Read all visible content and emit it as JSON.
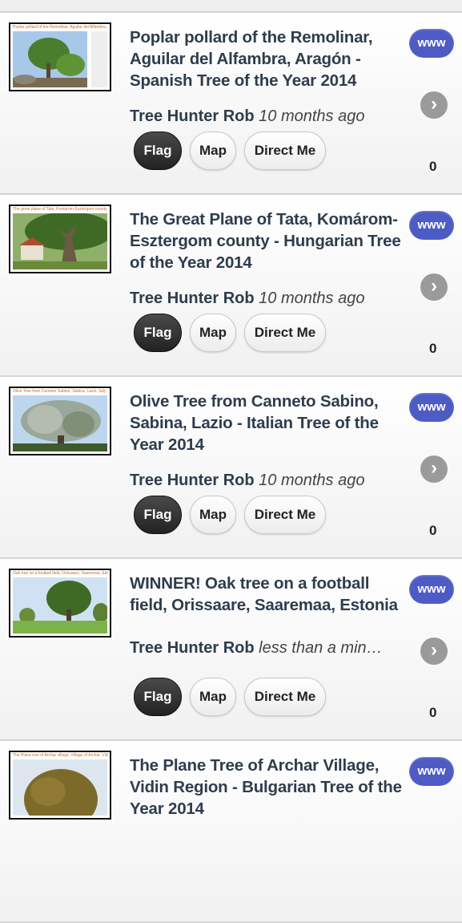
{
  "buttons": {
    "www": "www",
    "flag": "Flag",
    "map": "Map",
    "direct": "Direct Me",
    "arrow": "›"
  },
  "items": [
    {
      "title": "Poplar pollard of the Remolinar, Aguilar del Alfambra, Aragón - Spanish Tree of the Year 2014",
      "author": "Tree Hunter Rob",
      "time": "10 months ago",
      "count": "0",
      "thumb_caption": "Poplar pollard of the Remolinar, Aguilar del Alfambra, Aragón, Spain"
    },
    {
      "title": "The Great Plane of Tata, Komárom-Esztergom county - Hungarian Tree of the Year 2014",
      "author": "Tree Hunter Rob",
      "time": "10 months ago",
      "count": "0",
      "thumb_caption": "The great plane of Tata, Komárom-Esztergom county"
    },
    {
      "title": "Olive Tree from Canneto Sabino, Sabina, Lazio - Italian Tree of the Year 2014",
      "author": "Tree Hunter Rob",
      "time": "10 months ago",
      "count": "0",
      "thumb_caption": "Olive Tree from Canneto Sabino, Sabina, Lazio, Italy"
    },
    {
      "title": "WINNER! Oak tree on a football field, Orissaare, Saaremaa, Estonia",
      "author": "Tree Hunter Rob",
      "time": "less than a min…",
      "count": "0",
      "thumb_caption": "Oak tree on a football field, Orissaare, Saaremaa, Estonia"
    },
    {
      "title": "The Plane Tree of Archar Village, Vidin Region - Bulgarian Tree of the Year 2014",
      "author": "",
      "time": "",
      "count": "",
      "thumb_caption": "The Plane tree of Archar village, Village of Archar, Vidin Region"
    }
  ],
  "colors": {
    "www_button": "#4d5bc5",
    "title_text": "#2e3d4d",
    "flag_button": "#2a2a2a"
  }
}
